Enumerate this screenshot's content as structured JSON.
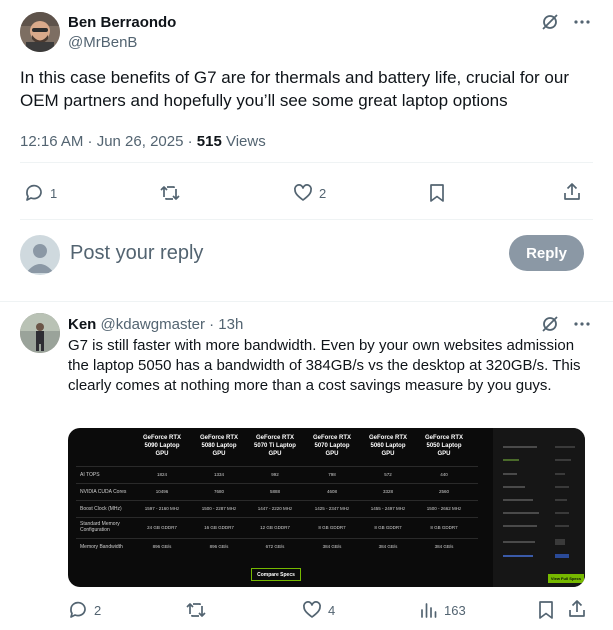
{
  "main_tweet": {
    "author_name": "Ben Berraondo",
    "author_handle": "@MrBenB",
    "text": "In this case benefits of G7 are for thermals and battery life, crucial for our OEM partners and hopefully you’ll see some great laptop options",
    "timestamp": "12:16 AM · Jun 26, 2025 · ",
    "views_count": "515",
    "views_label": " Views",
    "replies_count": "1",
    "likes_count": "2"
  },
  "reply_composer": {
    "placeholder": "Post your reply",
    "button_label": "Reply"
  },
  "reply_tweet": {
    "author_name": "Ken",
    "author_handle": "@kdawgmaster",
    "time_ago": "· 13h",
    "text": "G7 is still faster with more bandwidth. Even by your own websites admission the laptop 5050 has a bandwidth of 384GB/s vs the desktop at 320GB/s. This clearly comes at nothing more than a cost savings measure by you guys.",
    "replies_count": "2",
    "likes_count": "4",
    "views_count": "163"
  },
  "spec_image": {
    "columns": [
      "GeForce RTX 5090 Laptop GPU",
      "GeForce RTX 5080 Laptop GPU",
      "GeForce RTX 5070 Ti Laptop GPU",
      "GeForce RTX 5070 Laptop GPU",
      "GeForce RTX 5060 Laptop GPU",
      "GeForce RTX 5050 Laptop GPU"
    ],
    "rows": [
      {
        "label": "AI TOPS",
        "values": [
          "1824",
          "1334",
          "992",
          "798",
          "572",
          "440"
        ]
      },
      {
        "label": "NVIDIA CUDA Cores",
        "values": [
          "10496",
          "7680",
          "5888",
          "4608",
          "3328",
          "2560"
        ]
      },
      {
        "label": "Boost Clock (MHz)",
        "values": [
          "1597 - 2160 MHz",
          "1500 - 2287 MHz",
          "1447 - 2220 MHz",
          "1425 - 2347 MHz",
          "1455 - 2497 MHz",
          "1500 - 2662 MHz"
        ]
      },
      {
        "label": "Standard Memory Configuration",
        "values": [
          "24 GB GDDR7",
          "16 GB GDDR7",
          "12 GB GDDR7",
          "8 GB GDDR7",
          "8 GB GDDR7",
          "8 GB GDDR7"
        ]
      },
      {
        "label": "Memory Bandwidth",
        "values": [
          "896 GB/s",
          "896 GB/s",
          "672 GB/s",
          "384 GB/s",
          "384 GB/s",
          "384 GB/s"
        ]
      }
    ],
    "compare_label": "Compare Specs",
    "side_button_label": "View Full Specs"
  },
  "colors": {
    "accent_gray": "#8b98a5",
    "secondary_text": "#536471",
    "nvidia_green": "#76b900"
  }
}
